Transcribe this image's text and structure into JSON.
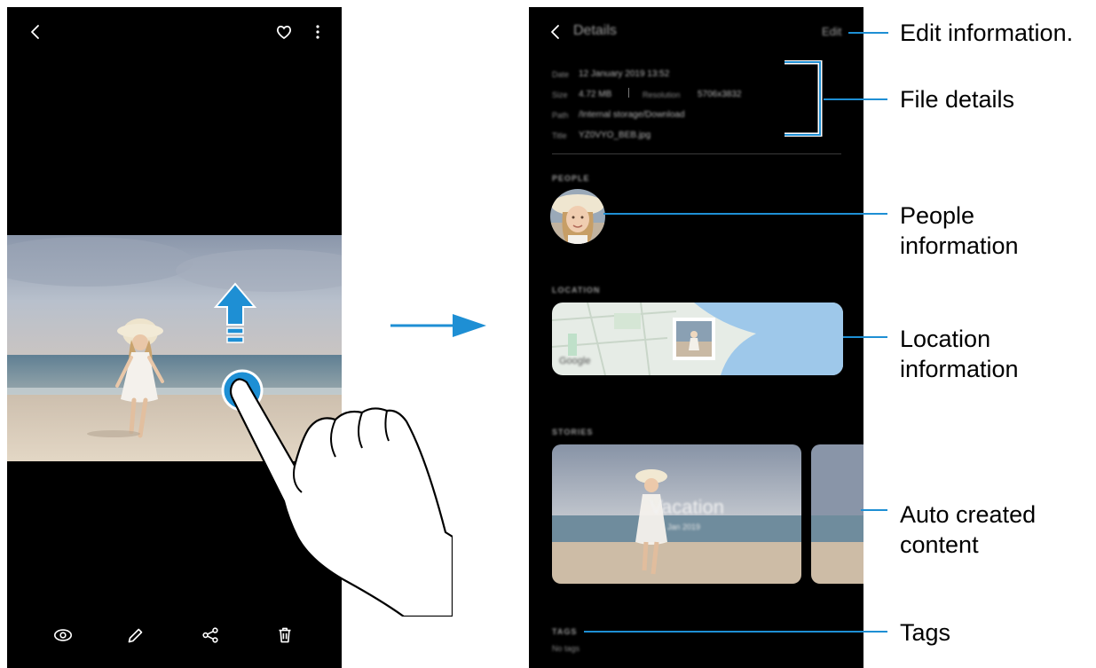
{
  "left_screen": {
    "top_icons": [
      "back-icon",
      "heart-icon",
      "more-options-icon"
    ],
    "bottom_icons": [
      "bixby-vision-icon",
      "edit-icon",
      "share-icon",
      "delete-icon"
    ]
  },
  "right_screen": {
    "header": {
      "title": "Details",
      "edit_label": "Edit"
    },
    "file_details": {
      "date_label": "Date",
      "date_value": "12 January 2019 13:52",
      "size_label": "Size",
      "size_value": "4.72 MB",
      "resolution_label": "Resolution",
      "resolution_value": "5706x3832",
      "path_label": "Path",
      "path_value": "/Internal storage/Download",
      "title_label": "Title",
      "title_value": "YZ0VYO_BEB.jpg"
    },
    "sections": {
      "people": "PEOPLE",
      "location": "LOCATION",
      "stories": "STORIES",
      "tags": "TAGS"
    },
    "map_brand": "Google",
    "story_title": "Vacation",
    "story_date": "Jan 2019",
    "tags_value": "No tags"
  },
  "callouts": {
    "edit": "Edit information.",
    "file": "File details",
    "people_1": "People",
    "people_2": "information",
    "location_1": "Location",
    "location_2": "information",
    "auto_1": "Auto created",
    "auto_2": "content",
    "tags": "Tags"
  },
  "colors": {
    "accent": "#1e8fd4",
    "screen_bg": "#000000"
  }
}
